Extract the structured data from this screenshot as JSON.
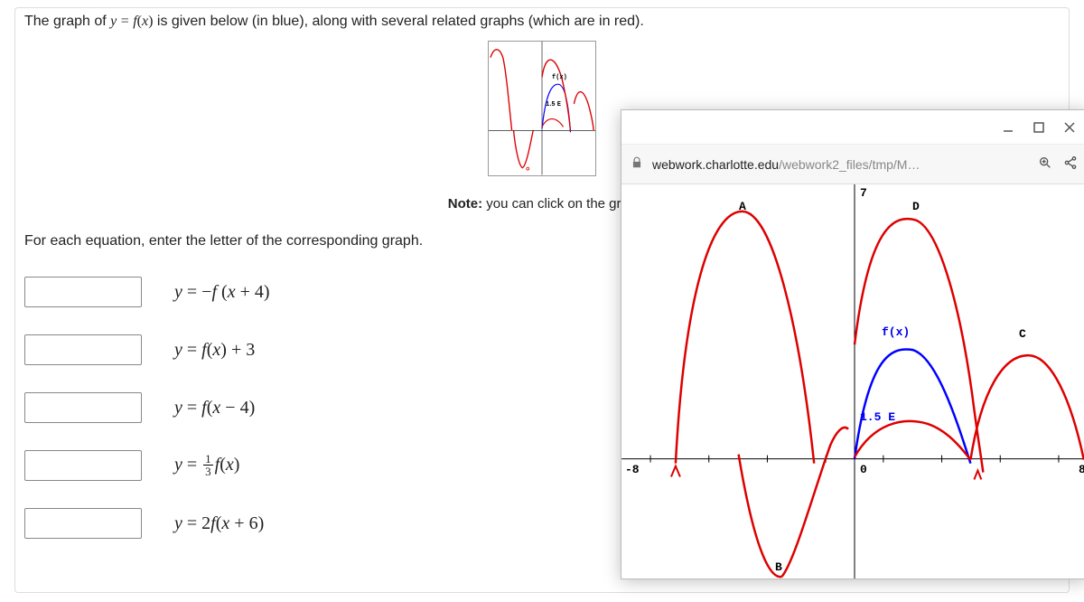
{
  "intro_prefix": "The graph of ",
  "intro_mid": " is given below (in blue), along with several related graphs (which are in red).",
  "note_label": "Note:",
  "note_text": " you can click on the grap",
  "instruction": "For each equation, enter the letter of the corresponding graph.",
  "equations": {
    "eq1": "y = −f (x + 4)",
    "eq2": "y = f(x) + 3",
    "eq3": "y = f(x − 4)",
    "eq4_pre": "y = ",
    "eq4_num": "1",
    "eq4_den": "3",
    "eq4_post": "f(x)",
    "eq5": "y = 2f(x + 6)"
  },
  "popup": {
    "url_host": "webwork.charlotte.edu",
    "url_path": "/webwork2_files/tmp/M…",
    "labels": {
      "A": "A",
      "B": "B",
      "C": "C",
      "D": "D",
      "E": "1.5 E",
      "fx": "f(x)",
      "xmin": "-8",
      "xmax": "8",
      "ymax": "7",
      "origin": "0"
    }
  },
  "thumb_labels": {
    "fx": "f(x)",
    "e": "E"
  }
}
